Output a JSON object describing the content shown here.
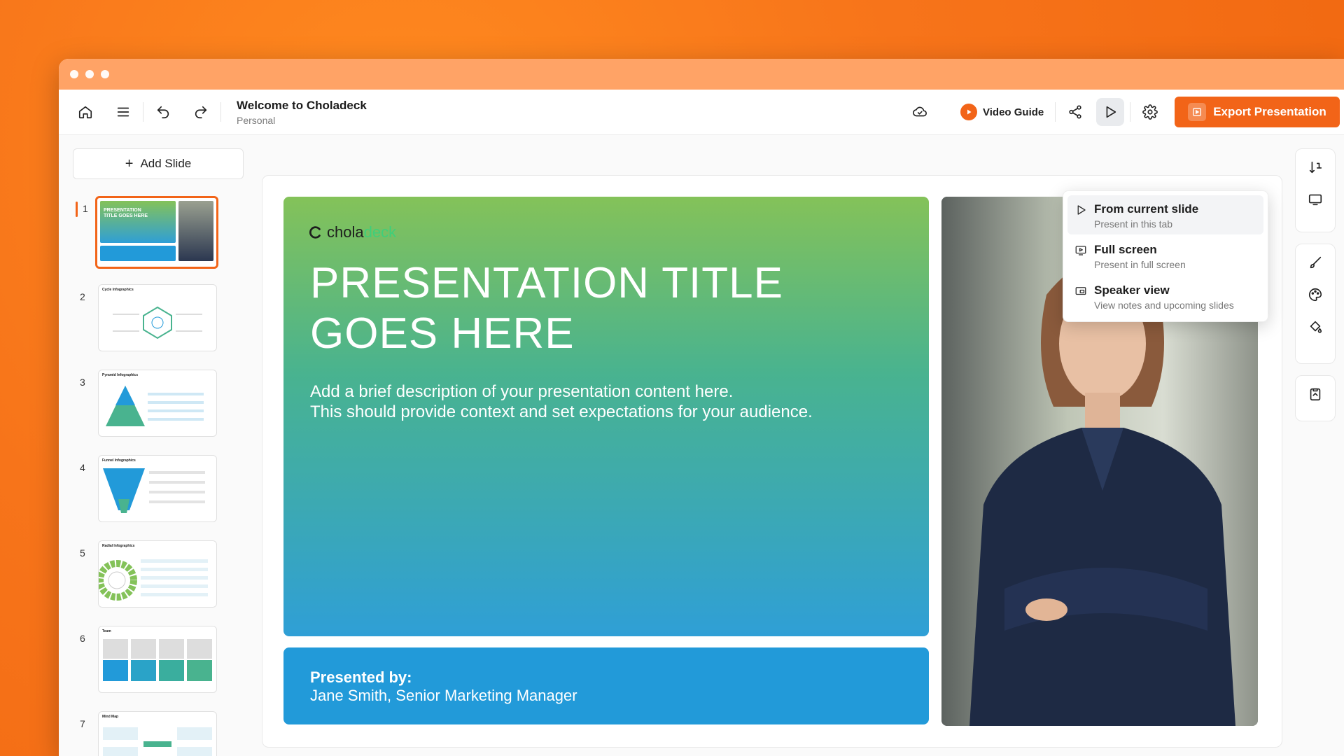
{
  "header": {
    "doc_title": "Welcome to Choladeck",
    "doc_subtitle": "Personal",
    "video_guide": "Video Guide",
    "export_label": "Export Presentation"
  },
  "sidebar": {
    "add_slide_label": "Add Slide",
    "slides": [
      {
        "num": "1",
        "title": "PRESENTATION TITLE GOES HERE"
      },
      {
        "num": "2",
        "title": "Cycle Infographics"
      },
      {
        "num": "3",
        "title": "Pyramid Infographics"
      },
      {
        "num": "4",
        "title": "Funnel Infographics"
      },
      {
        "num": "5",
        "title": "Radial Infographics"
      },
      {
        "num": "6",
        "title": "Team"
      },
      {
        "num": "7",
        "title": "Mind Map"
      }
    ]
  },
  "slide": {
    "logo_part1": "chola",
    "logo_part2": "deck",
    "title_line1": "PRESENTATION TITLE",
    "title_line2": "GOES HERE",
    "desc_line1": "Add a brief description of your presentation content here.",
    "desc_line2": "This should provide context and set expectations for your audience.",
    "presented_label": "Presented by:",
    "presenter": "Jane Smith, Senior Marketing Manager"
  },
  "present_menu": {
    "items": [
      {
        "title": "From current slide",
        "subtitle": "Present in this tab"
      },
      {
        "title": "Full screen",
        "subtitle": "Present in full screen"
      },
      {
        "title": "Speaker view",
        "subtitle": "View notes and upcoming slides"
      }
    ]
  },
  "colors": {
    "accent": "#f26418",
    "slide_gradient_top": "#84c259",
    "slide_gradient_bottom": "#2f9fd6",
    "presenter_band": "#229ad9"
  }
}
